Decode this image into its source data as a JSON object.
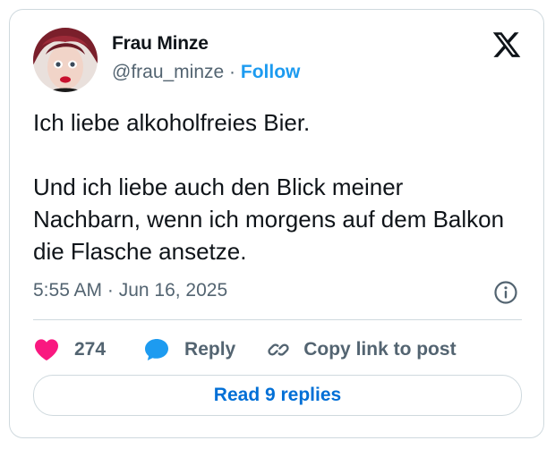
{
  "author": {
    "name": "Frau Minze",
    "handle": "@frau_minze",
    "separator": "·",
    "follow_label": "Follow"
  },
  "tweet": {
    "paragraphs": [
      "Ich liebe alkoholfreies Bier.",
      "Und ich liebe auch den Blick meiner Nachbarn, wenn ich morgens auf dem Balkon die Flasche ansetze."
    ],
    "timestamp": "5:55 AM · Jun 16, 2025"
  },
  "actions": {
    "like_count": "274",
    "reply_label": "Reply",
    "copy_link_label": "Copy link to post"
  },
  "read_replies_label": "Read 9 replies",
  "icons": {
    "logo": "x-logo-icon",
    "info": "info-icon",
    "like": "heart-icon",
    "reply": "speech-bubble-icon",
    "copy": "link-icon"
  },
  "colors": {
    "heart": "#f91880",
    "reply_bubble": "#1d9bf0",
    "follow": "#1d9bf0",
    "read_replies_text": "#006fd6",
    "secondary_text": "#536471",
    "border": "#cfd9de"
  }
}
